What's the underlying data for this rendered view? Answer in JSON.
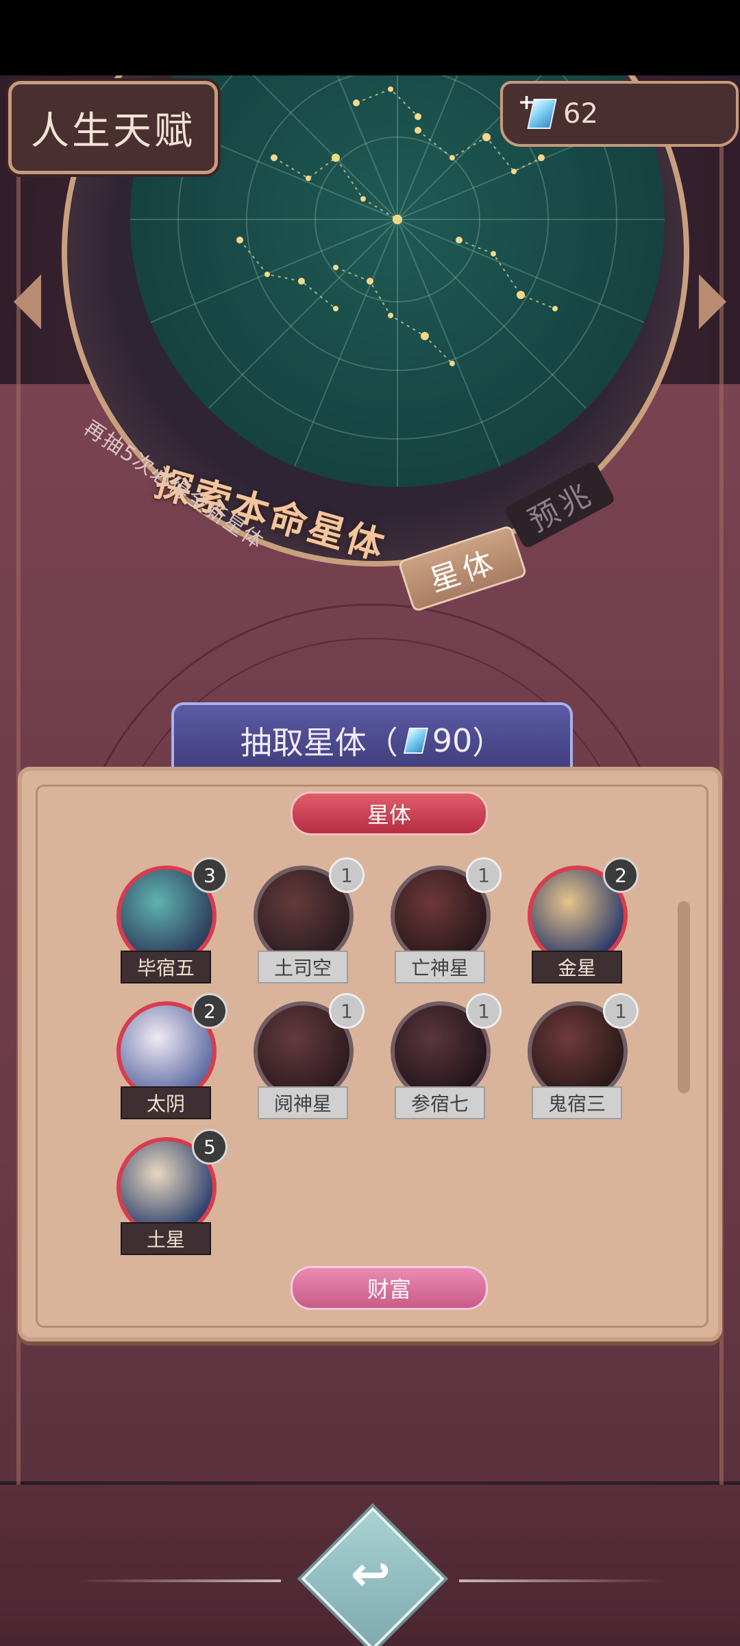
{
  "header": {
    "title": "人生天赋",
    "currency": {
      "value": "62",
      "icon": "gem-icon",
      "plus": "+"
    }
  },
  "dial": {
    "title": "探索本命星体",
    "pity_text": "再抽5次必得全新星体",
    "tabs": [
      {
        "label": "星体",
        "active": true
      },
      {
        "label": "预兆",
        "active": false
      }
    ]
  },
  "draw_button": {
    "prefix": "抽取星体（",
    "cost": "90",
    "suffix": "）"
  },
  "panel": {
    "section_label": "星体",
    "next_section_label": "财富",
    "cards": [
      {
        "name": "毕宿五",
        "count": "3",
        "owned": true,
        "colors": [
          "#5fb3b0",
          "#2d3a5a"
        ]
      },
      {
        "name": "土司空",
        "count": "1",
        "owned": false,
        "colors": [
          "#8a3f3f",
          "#3a1f28"
        ]
      },
      {
        "name": "亡神星",
        "count": "1",
        "owned": false,
        "colors": [
          "#9a3a3a",
          "#3a1a20"
        ]
      },
      {
        "name": "金星",
        "count": "2",
        "owned": true,
        "colors": [
          "#e7c48a",
          "#2b3a6a"
        ]
      },
      {
        "name": "太阴",
        "count": "2",
        "owned": true,
        "colors": [
          "#f1eaf5",
          "#5b6aa0"
        ]
      },
      {
        "name": "阋神星",
        "count": "1",
        "owned": false,
        "colors": [
          "#8a3e46",
          "#3d1c25"
        ]
      },
      {
        "name": "参宿七",
        "count": "1",
        "owned": false,
        "colors": [
          "#7d3a48",
          "#2e1620"
        ]
      },
      {
        "name": "鬼宿三",
        "count": "1",
        "owned": false,
        "colors": [
          "#9c3d3d",
          "#3a1a1c"
        ]
      },
      {
        "name": "土星",
        "count": "5",
        "owned": true,
        "colors": [
          "#e9d8c0",
          "#2b3f6c"
        ]
      }
    ]
  },
  "nav": {
    "back_icon": "return-icon",
    "back_glyph": "↩"
  }
}
